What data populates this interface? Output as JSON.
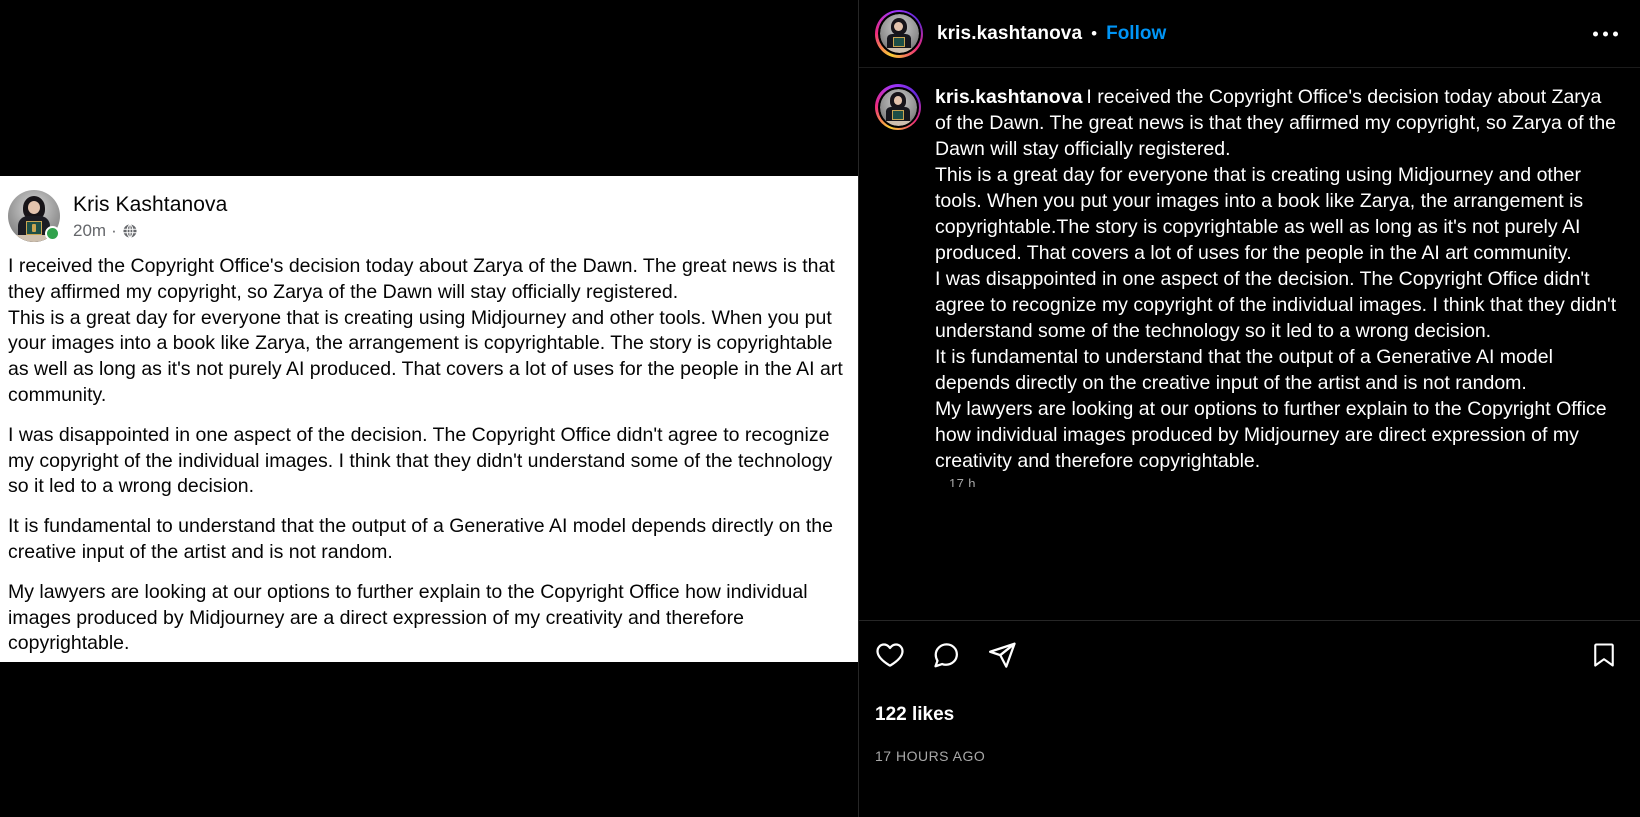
{
  "facebook": {
    "author_name": "Kris Kashtanova",
    "timestamp": "20m",
    "separator": "·",
    "privacy_icon": "globe-icon",
    "online_badge": "online-status-badge",
    "paragraphs": [
      "I received the Copyright Office's decision today about Zarya of the Dawn. The great news is that they affirmed my copyright, so Zarya of the Dawn will stay officially registered.\nThis is a great day for everyone that is creating using Midjourney and other tools. When you put your images into a book like Zarya, the arrangement is copyrightable. The story is copyrightable as well as long as it's not purely AI produced. That covers a lot of uses for the people in the AI art community.",
      "I was disappointed in one aspect of the decision. The Copyright Office didn't agree to recognize my copyright of the individual images. I think that they didn't understand some of the technology so it led to a wrong decision.",
      "It is fundamental to understand that the output of a Generative AI model depends directly on the creative input of the artist and is not random.",
      "My lawyers are looking at our options to further explain to the Copyright Office how individual images produced by Midjourney are a direct expression of my creativity and therefore copyrightable."
    ]
  },
  "instagram": {
    "header": {
      "username": "kris.kashtanova",
      "separator": "•",
      "follow_label": "Follow",
      "more_icon": "more-options-icon",
      "avatar_icon": "profile-avatar"
    },
    "caption": {
      "username": "kris.kashtanova",
      "body": "I received the Copyright Office's decision today about Zarya of the Dawn. The great news is that they affirmed my copyright, so Zarya of the Dawn will stay officially registered.\nThis is a great day for everyone that is creating using Midjourney and other tools. When you put your images into a book like Zarya, the arrangement is copyrightable.The story is copyrightable as well as long as it's not purely AI produced. That covers a lot of uses for the people in the AI art community.\nI was disappointed in one aspect of the decision. The Copyright Office didn't agree to recognize my copyright of the individual images. I think that they didn't understand some of the technology so it led to a wrong decision.\nIt is fundamental to understand that the output of a Generative AI model depends directly on the creative input of the artist and is not random.\nMy lawyers are looking at our options to further explain to the Copyright Office how individual images produced by Midjourney are direct expression of my creativity and therefore copyrightable.",
      "relative_time": "17 h"
    },
    "actions": {
      "like_icon": "heart-icon",
      "comment_icon": "comment-icon",
      "share_icon": "share-icon",
      "save_icon": "bookmark-icon"
    },
    "likes_label": "122 likes",
    "posted_time": "17 HOURS AGO"
  },
  "colors": {
    "instagram_link": "#0095f6",
    "facebook_text": "#050505",
    "facebook_secondary": "#65676b",
    "instagram_secondary": "#a8a8a8",
    "online_green": "#31a24c",
    "background": "#000000",
    "card": "#ffffff"
  }
}
